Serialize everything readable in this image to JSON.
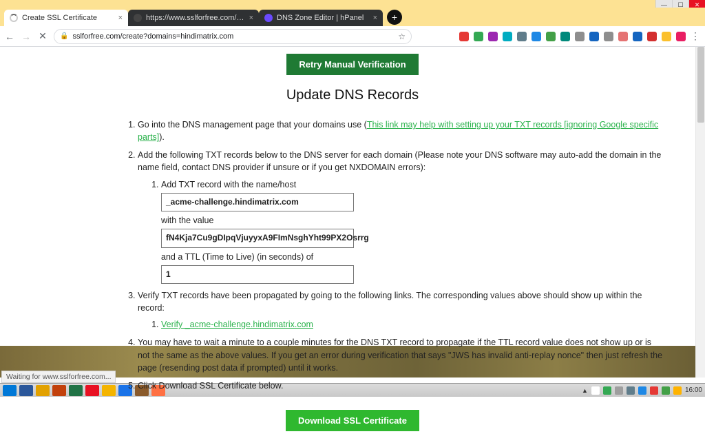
{
  "window": {
    "tabs": [
      {
        "title": "Create SSL Certificate",
        "active": true
      },
      {
        "title": "https://www.sslforfree.com/creat",
        "active": false
      },
      {
        "title": "DNS Zone Editor | hPanel",
        "active": false
      }
    ],
    "win_buttons": {
      "min": "—",
      "max": "☐",
      "close": "✕"
    }
  },
  "toolbar": {
    "url": "sslforfree.com/create?domains=hindimatrix.com",
    "ext_colors": [
      "#e53935",
      "#34a853",
      "#9c27b0",
      "#00acc1",
      "#607d8b",
      "#1e88e5",
      "#43a047",
      "#00897b",
      "#8e8e8e",
      "#1565c0",
      "#8e8e8e",
      "#e57373",
      "#1565c0",
      "#d32f2f",
      "#fbc02d",
      "#e91e63"
    ]
  },
  "page": {
    "retry_btn": "Retry Manual Verification",
    "heading": "Update DNS Records",
    "step1_a": "Go into the DNS management page that your domains use (",
    "step1_link": "This link may help with setting up your TXT records [ignoring Google specific parts]",
    "step1_b": ").",
    "step2": "Add the following TXT records below to the DNS server for each domain (Please note your DNS software may auto-add the domain in the name field, contact DNS provider if unsure or if you get NXDOMAIN errors):",
    "step2_sub1": "Add TXT record with the name/host",
    "txt_host": "_acme-challenge.hindimatrix.com",
    "with_value": "with the value",
    "txt_value": "fN4Kja7Cu9gDIpqVjuyyxA9FImNsghYht99PX2Osrrg",
    "ttl_label": "and a TTL (Time to Live) (in seconds) of",
    "ttl_value": "1",
    "step3": "Verify TXT records have been propagated by going to the following links. The corresponding values above should show up within the record:",
    "step3_link": "Verify _acme-challenge.hindimatrix.com",
    "step4": "You may have to wait a minute to a couple minutes for the DNS TXT record to propagate if the TTL record value does not show up or is not the same as the above values. If you get an error during verification that says \"JWS has invalid anti-replay nonce\" then just refresh the page (resending post data if prompted) until it works.",
    "step5": "Click Download SSL Certificate below.",
    "download_btn": "Download SSL Certificate"
  },
  "status": "Waiting for www.sslforfree.com...",
  "taskbar": {
    "apps": [
      "#0078d7",
      "#2b579a",
      "#e2a100",
      "#c2410c",
      "#217346",
      "#e81123",
      "#f4b400",
      "#1a73e8",
      "#8a5a2b",
      "#ff7043"
    ],
    "tray": [
      "#ffffff",
      "#34a853",
      "#9e9e9e",
      "#607d8b",
      "#1e88e5",
      "#e53935",
      "#43a047",
      "#ffb300"
    ],
    "clock": "16:00"
  }
}
